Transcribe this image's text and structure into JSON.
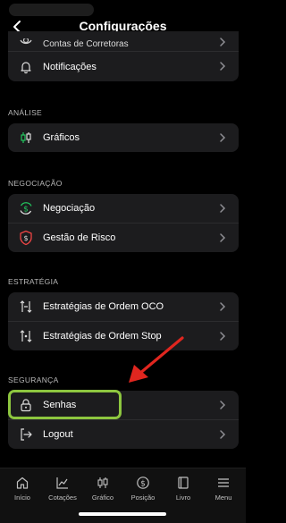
{
  "header": {
    "title": "Configurações"
  },
  "top_card": {
    "partial_label": "Contas de Corretoras",
    "notifications_label": "Notificações"
  },
  "sections": {
    "analise": {
      "label": "ANÁLISE",
      "items": [
        "Gráficos"
      ]
    },
    "negociacao": {
      "label": "NEGOCIAÇÃO",
      "items": [
        "Negociação",
        "Gestão de Risco"
      ]
    },
    "estrategia": {
      "label": "ESTRATÉGIA",
      "items": [
        "Estratégias de Ordem OCO",
        "Estratégias de Ordem Stop"
      ]
    },
    "seguranca": {
      "label": "SEGURANÇA",
      "items": [
        "Senhas",
        "Logout"
      ]
    }
  },
  "tabbar": {
    "tabs": [
      "Início",
      "Cotações",
      "Gráfico",
      "Posição",
      "Livro",
      "Menu"
    ]
  },
  "colors": {
    "highlight": "#8dc63f",
    "arrow": "#e0261f",
    "accent_green": "#22c55e",
    "accent_red": "#ef4444"
  }
}
